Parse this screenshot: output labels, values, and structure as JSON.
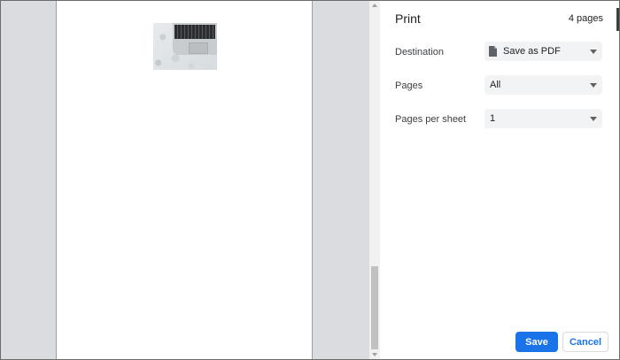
{
  "print_panel": {
    "title": "Print",
    "page_count": "4 pages",
    "destination": {
      "label": "Destination",
      "value": "Save as PDF",
      "icon": "document-icon"
    },
    "pages": {
      "label": "Pages",
      "value": "All"
    },
    "pages_per_sheet": {
      "label": "Pages per sheet",
      "value": "1"
    },
    "save_label": "Save",
    "cancel_label": "Cancel"
  },
  "colors": {
    "accent": "#1a73e8",
    "preview_background": "#dadce0",
    "select_background": "#f1f3f4"
  }
}
